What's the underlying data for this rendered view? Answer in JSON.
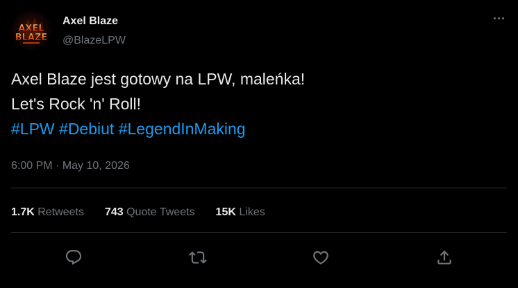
{
  "author": {
    "name": "Axel Blaze",
    "handle": "@BlazeLPW",
    "avatar_text_top": "AXEL",
    "avatar_text_bottom": "BLAZE"
  },
  "tweet": {
    "line1": "Axel Blaze jest gotowy na LPW, maleńka!",
    "line2": "Let's Rock 'n' Roll!",
    "hashtags": [
      "#LPW",
      "#Debiut",
      "#LegendInMaking"
    ]
  },
  "meta": {
    "time": "6:00 PM",
    "separator": " · ",
    "date": "May 10, 2026"
  },
  "stats": {
    "retweets_value": "1.7K",
    "retweets_label": "Retweets",
    "quotes_value": "743",
    "quotes_label": "Quote Tweets",
    "likes_value": "15K",
    "likes_label": "Likes"
  },
  "actions": {
    "reply_icon": "reply-icon",
    "retweet_icon": "retweet-icon",
    "like_icon": "heart-icon",
    "share_icon": "share-icon"
  },
  "colors": {
    "background": "#000000",
    "text": "#e7e9ea",
    "secondary": "#71767b",
    "link": "#1d9bf0",
    "divider": "#2f3336"
  }
}
